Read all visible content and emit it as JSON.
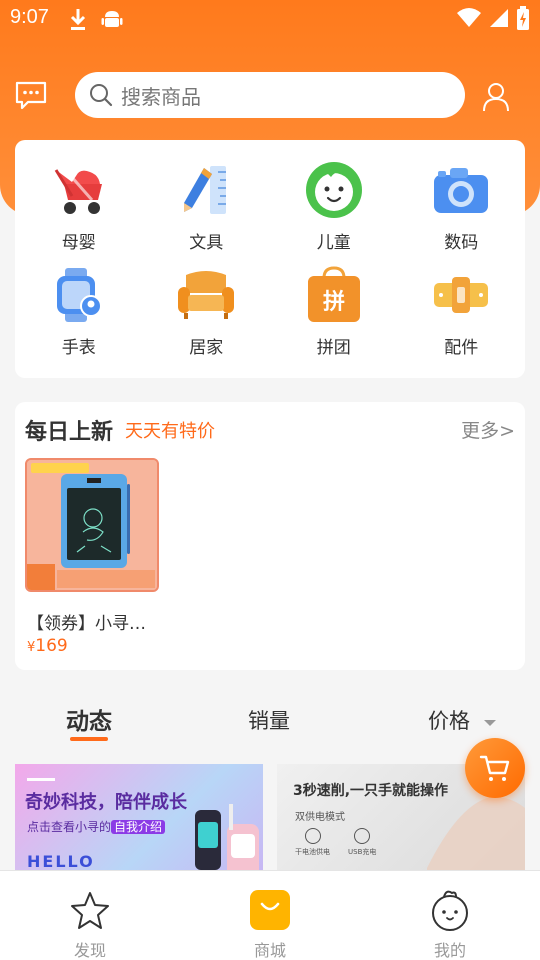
{
  "status_bar": {
    "time": "9:07"
  },
  "search": {
    "placeholder": "搜索商品"
  },
  "categories": [
    {
      "label": "母婴",
      "icon": "stroller-icon"
    },
    {
      "label": "文具",
      "icon": "pencil-ruler-icon"
    },
    {
      "label": "儿童",
      "icon": "child-face-icon"
    },
    {
      "label": "数码",
      "icon": "camera-icon"
    },
    {
      "label": "手表",
      "icon": "watch-icon"
    },
    {
      "label": "居家",
      "icon": "sofa-icon"
    },
    {
      "label": "拼团",
      "icon": "group-buy-bag-icon"
    },
    {
      "label": "配件",
      "icon": "accessory-icon"
    }
  ],
  "daily": {
    "title": "每日上新",
    "subtitle": "天天有特价",
    "more": "更多>",
    "product": {
      "name": "【领券】小寻…",
      "currency": "¥",
      "price": "169"
    }
  },
  "sort_tabs": {
    "dynamic": "动态",
    "sales": "销量",
    "price": "价格"
  },
  "banners": {
    "b1_title": "奇妙科技，陪伴成长",
    "b1_sub_prefix": "点击查看小寻的",
    "b1_sub_highlight": "自我介绍",
    "b1_hello": "HELLO",
    "b2_title": "3秒速削,一只手就能操作",
    "b2_sub": "双供电模式",
    "b2_feat1": "干电池供电",
    "b2_feat2": "USB充电"
  },
  "bottom_nav": [
    {
      "label": "发现",
      "icon": "star-icon"
    },
    {
      "label": "商城",
      "icon": "shopping-bag-icon"
    },
    {
      "label": "我的",
      "icon": "mascot-face-icon"
    }
  ],
  "colors": {
    "accent": "#ff6a1a",
    "header": "#ff7a1c",
    "nav_active": "#ffb400"
  }
}
